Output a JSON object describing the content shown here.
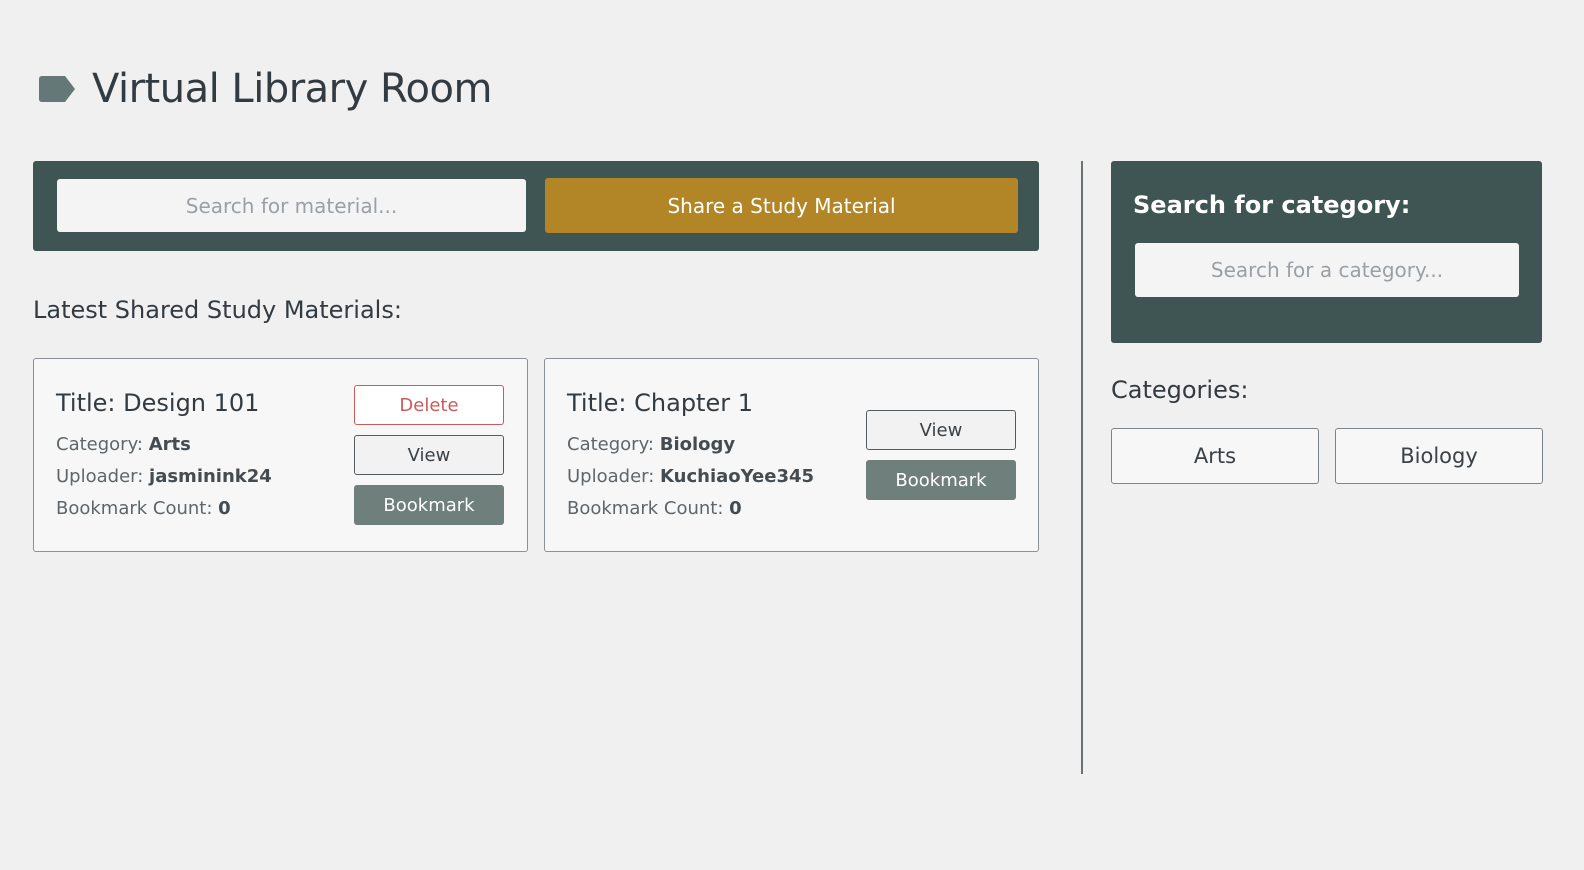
{
  "header": {
    "title": "Virtual Library Room",
    "icon": "tag-icon"
  },
  "toolbar": {
    "search_placeholder": "Search for material...",
    "search_value": "",
    "share_label": "Share a Study Material"
  },
  "materials": {
    "heading": "Latest Shared Study Materials:",
    "items": [
      {
        "title": "Title: Design 101",
        "category_label": "Category:",
        "category": "Arts",
        "uploader_label": "Uploader:",
        "uploader": "jasminink24",
        "bookmark_label": "Bookmark Count:",
        "bookmark_count": "0",
        "delete_label": "Delete",
        "view_label": "View",
        "bookmark_button": "Bookmark"
      },
      {
        "title": "Title: Chapter 1",
        "category_label": "Category:",
        "category": "Biology",
        "uploader_label": "Uploader:",
        "uploader": "KuchiaoYee345",
        "bookmark_label": "Bookmark Count:",
        "bookmark_count": "0",
        "view_label": "View",
        "bookmark_button": "Bookmark"
      }
    ]
  },
  "category_search": {
    "label": "Search for category:",
    "placeholder": "Search for a category...",
    "value": ""
  },
  "categories": {
    "heading": "Categories:",
    "items": [
      "Arts",
      "Biology"
    ]
  },
  "colors": {
    "panel": "#3e5553",
    "accent": "#b28627",
    "danger": "#c95b5b",
    "bookmark": "#6f7f7c"
  }
}
